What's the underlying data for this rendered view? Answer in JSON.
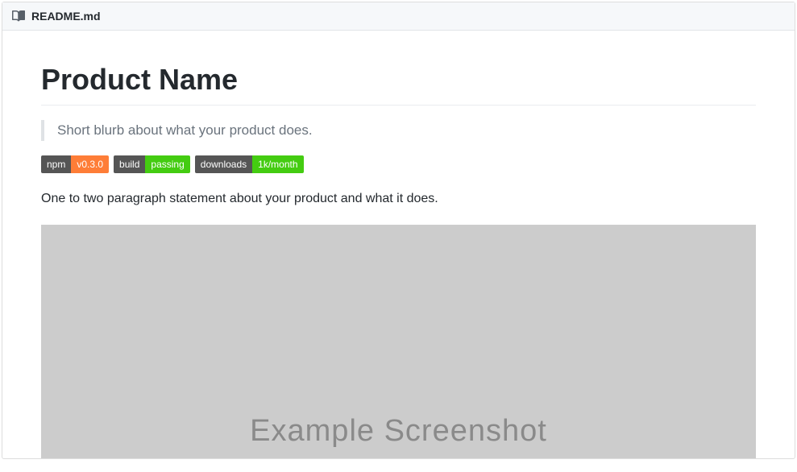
{
  "header": {
    "filename": "README.md"
  },
  "content": {
    "title": "Product Name",
    "blurb": "Short blurb about what your product does.",
    "description": "One to two paragraph statement about your product and what it does.",
    "screenshot_label": "Example Screenshot"
  },
  "badges": [
    {
      "left": "npm",
      "right": "v0.3.0",
      "right_color": "orange"
    },
    {
      "left": "build",
      "right": "passing",
      "right_color": "green"
    },
    {
      "left": "downloads",
      "right": "1k/month",
      "right_color": "green"
    }
  ]
}
